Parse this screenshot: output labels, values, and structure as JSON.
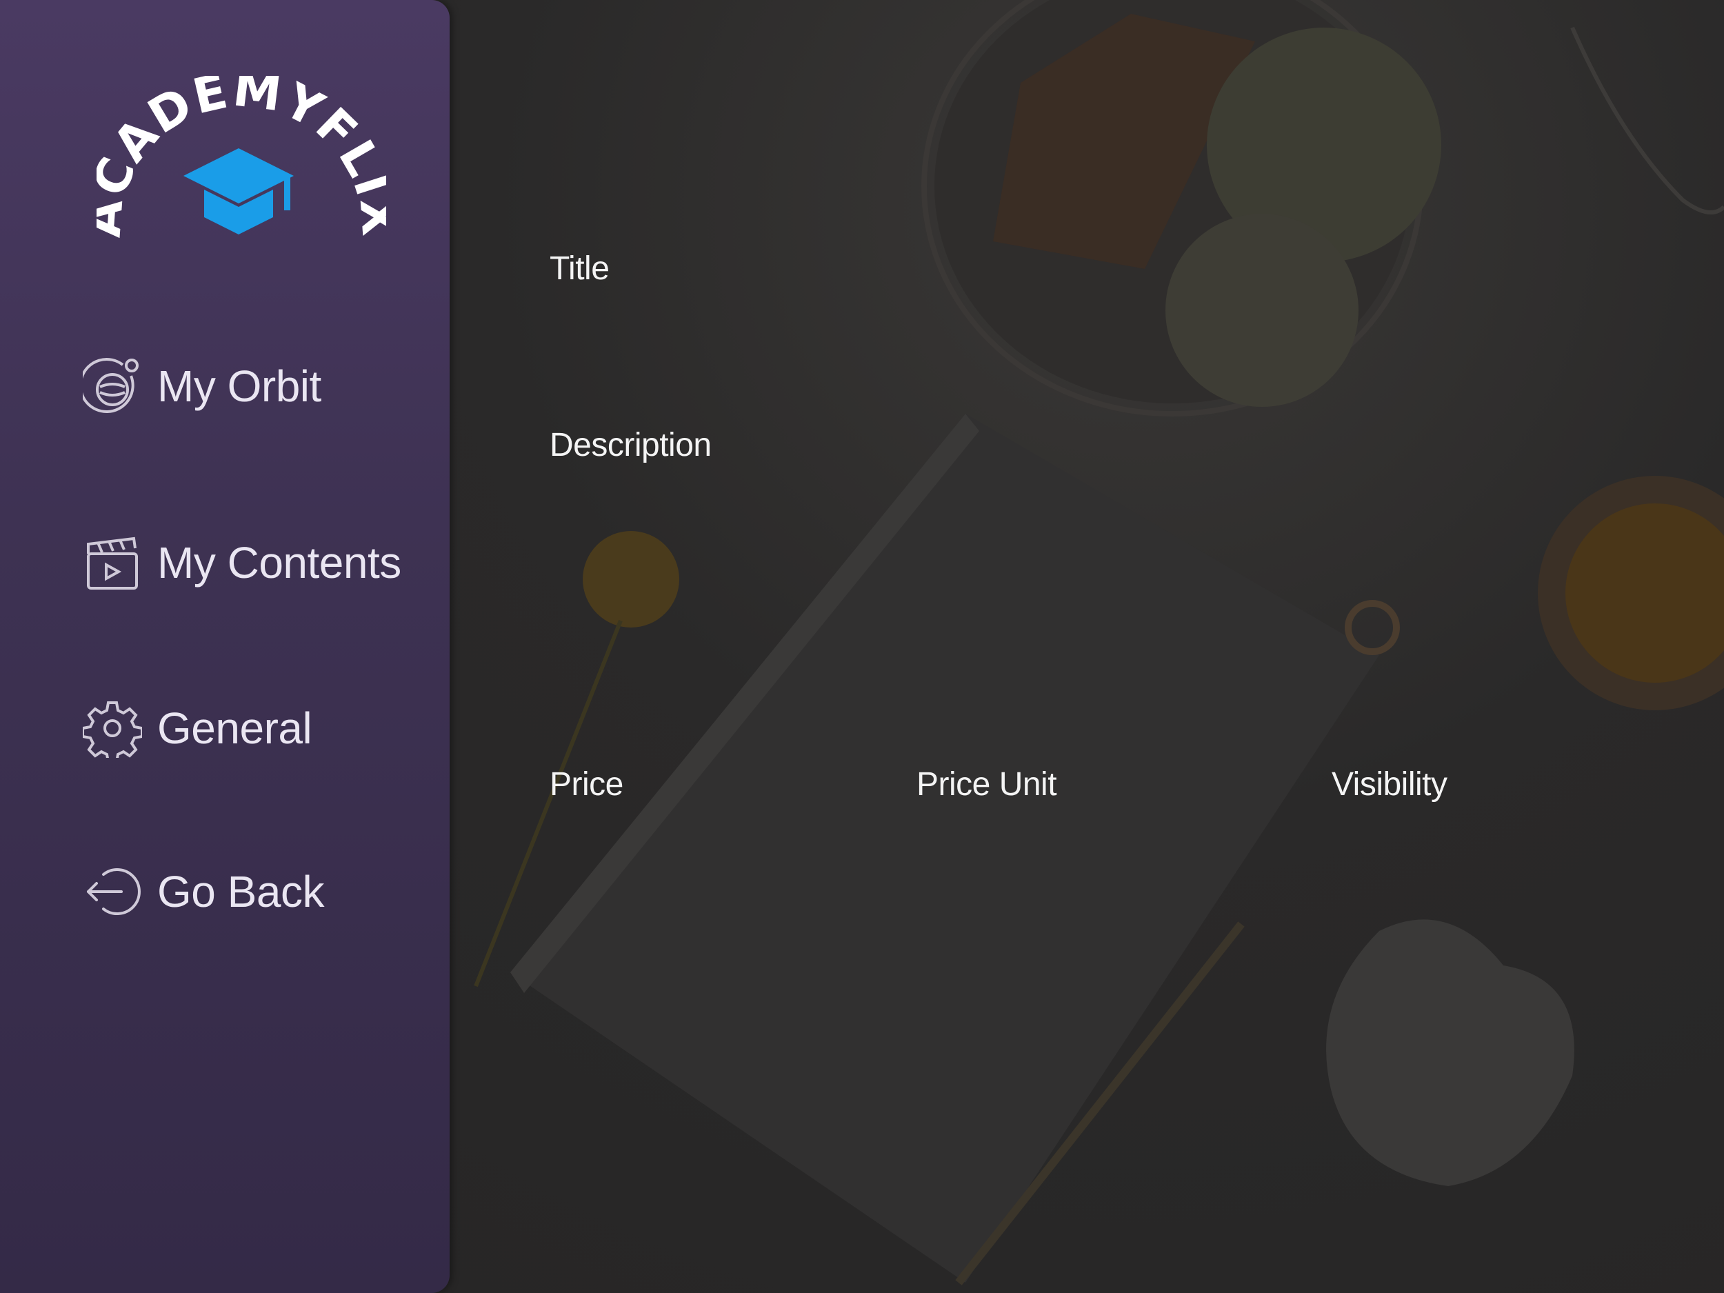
{
  "brand": {
    "name": "ACADEMYFLIX",
    "accent": "#1a9de8"
  },
  "sidebar": {
    "items": [
      {
        "label": "My Orbit",
        "icon": "orbit-icon"
      },
      {
        "label": "My Contents",
        "icon": "clapperboard-icon"
      },
      {
        "label": "General",
        "icon": "gear-icon"
      },
      {
        "label": "Go Back",
        "icon": "logout-icon"
      }
    ]
  },
  "form": {
    "title_label": "Title",
    "description_label": "Description",
    "price_label": "Price",
    "price_unit_label": "Price Unit",
    "visibility_label": "Visibility"
  },
  "colors": {
    "sidebar_top": "#4a3a62",
    "sidebar_bottom": "#342a47",
    "background": "#2b2a2a"
  }
}
